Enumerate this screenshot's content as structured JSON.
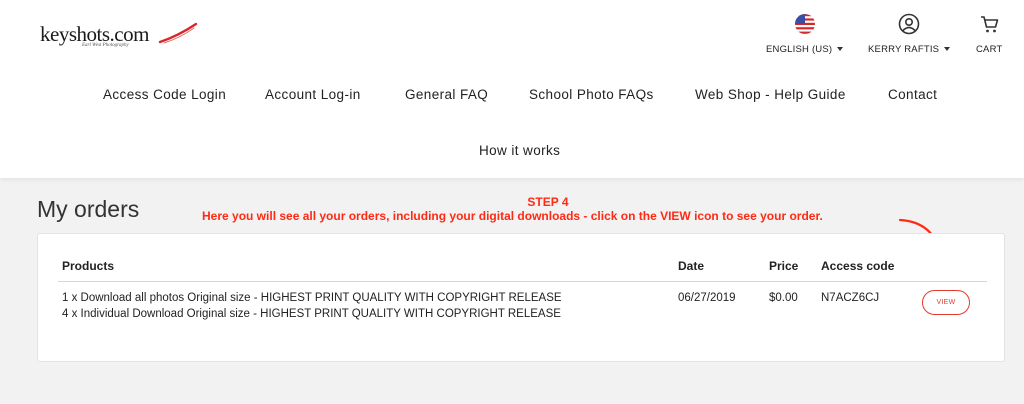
{
  "header": {
    "logo_text": "keyshots.com",
    "logo_tagline": "Earl West Photography",
    "language_label": "ENGLISH (US)",
    "user_label": "KERRY RAFTIS",
    "cart_label": "CART"
  },
  "nav": {
    "items": [
      {
        "label": "Access Code Login"
      },
      {
        "label": "Account Log-in"
      },
      {
        "label": "General FAQ"
      },
      {
        "label": "School Photo FAQs"
      },
      {
        "label": "Web Shop - Help Guide"
      },
      {
        "label": "Contact"
      },
      {
        "label": "How it works"
      }
    ]
  },
  "page": {
    "title": "My orders"
  },
  "annotation": {
    "step": "STEP 4",
    "text": "Here you will see all your orders, including your digital downloads - click on the VIEW icon to see your order.",
    "color": "#ff2a14"
  },
  "orders": {
    "headers": {
      "products": "Products",
      "date": "Date",
      "price": "Price",
      "access_code": "Access code"
    },
    "rows": [
      {
        "products": [
          "1 x Download all photos Original size - HIGHEST PRINT QUALITY WITH COPYRIGHT RELEASE",
          "4 x Individual Download Original size - HIGHEST PRINT QUALITY WITH COPYRIGHT RELEASE"
        ],
        "date": "06/27/2019",
        "price": "$0.00",
        "access_code": "N7ACZ6CJ",
        "view_label": "VIEW"
      }
    ]
  },
  "colors": {
    "accent": "#e23b2d",
    "background": "#f2f2f3"
  },
  "icons": {
    "flag": "us-flag-icon",
    "user": "user-circle-icon",
    "cart": "cart-icon"
  }
}
